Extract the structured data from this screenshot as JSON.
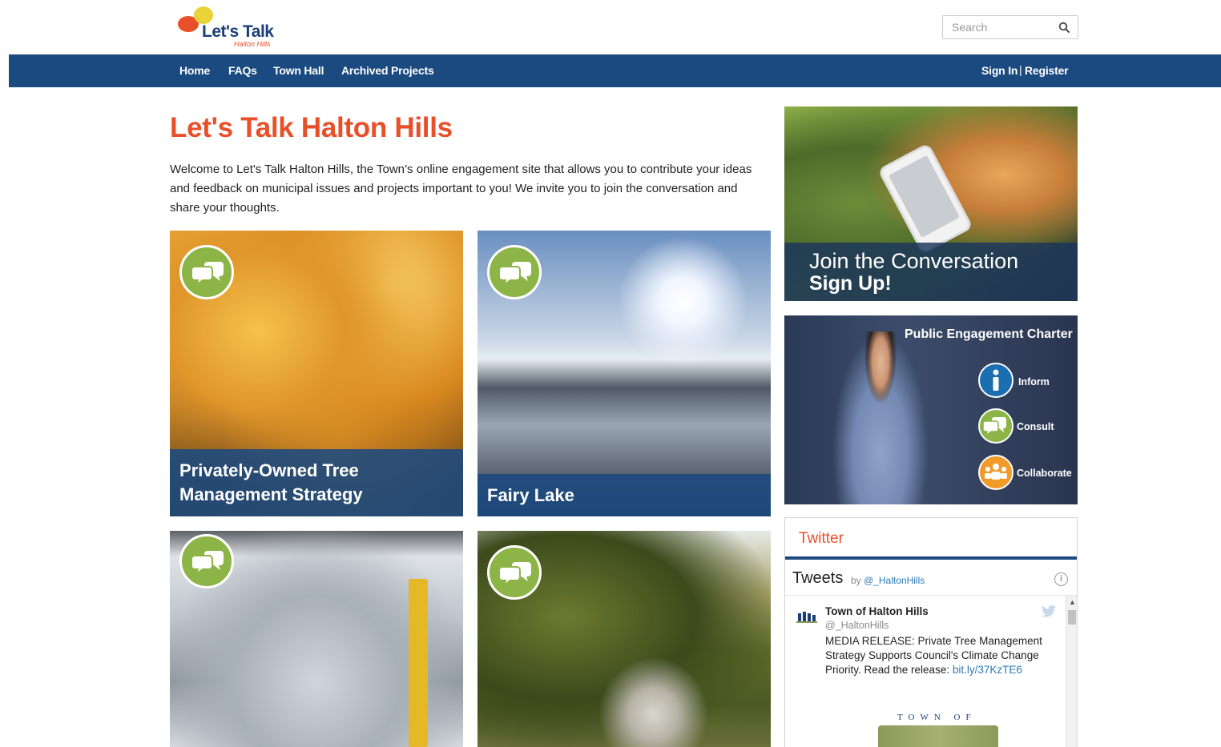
{
  "header": {
    "logo": {
      "name": "Let's Talk",
      "subtitle": "Halton Hills"
    },
    "search": {
      "placeholder": "Search"
    }
  },
  "nav": {
    "items": [
      {
        "label": "Home"
      },
      {
        "label": "FAQs"
      },
      {
        "label": "Town Hall"
      },
      {
        "label": "Archived Projects"
      }
    ],
    "sign_in": "Sign In",
    "separator": "|",
    "register": "Register"
  },
  "main": {
    "title": "Let's Talk Halton Hills",
    "intro": "Welcome to Let's Talk Halton Hills, the Town’s online engagement site that allows you to contribute your ideas and feedback on municipal issues and projects important to you! We invite you to join the conversation and share your thoughts.",
    "projects": [
      {
        "label": "Privately-Owned Tree Management Strategy"
      },
      {
        "label": "Fairy Lake"
      },
      {
        "label": ""
      },
      {
        "label": ""
      }
    ]
  },
  "sidebar": {
    "join": {
      "line1": "Join the Conversation",
      "line2": "Sign Up!"
    },
    "charter": {
      "title": "Public Engagement Charter",
      "items": [
        {
          "label": "Inform",
          "color": "#1b6fb0",
          "icon": "info-icon"
        },
        {
          "label": "Consult",
          "color": "#8cb447",
          "icon": "chat-bubbles-icon"
        },
        {
          "label": "Collaborate",
          "color": "#f09a2a",
          "icon": "people-icon"
        }
      ]
    },
    "twitter": {
      "heading": "Twitter",
      "tweets_label": "Tweets",
      "by": "by",
      "handle_link": "@_HaltonHills",
      "tweet": {
        "name": "Town of Halton Hills",
        "handle": "@_HaltonHills",
        "text": "MEDIA RELEASE:  Private Tree Management Strategy Supports Council's Climate Change Priority. Read the release: ",
        "link": "bit.ly/37KzTE6",
        "image_text": "TOWN OF"
      }
    }
  },
  "colors": {
    "accent": "#e8502a",
    "nav": "#1b4a80",
    "badge": "#8cb447"
  }
}
